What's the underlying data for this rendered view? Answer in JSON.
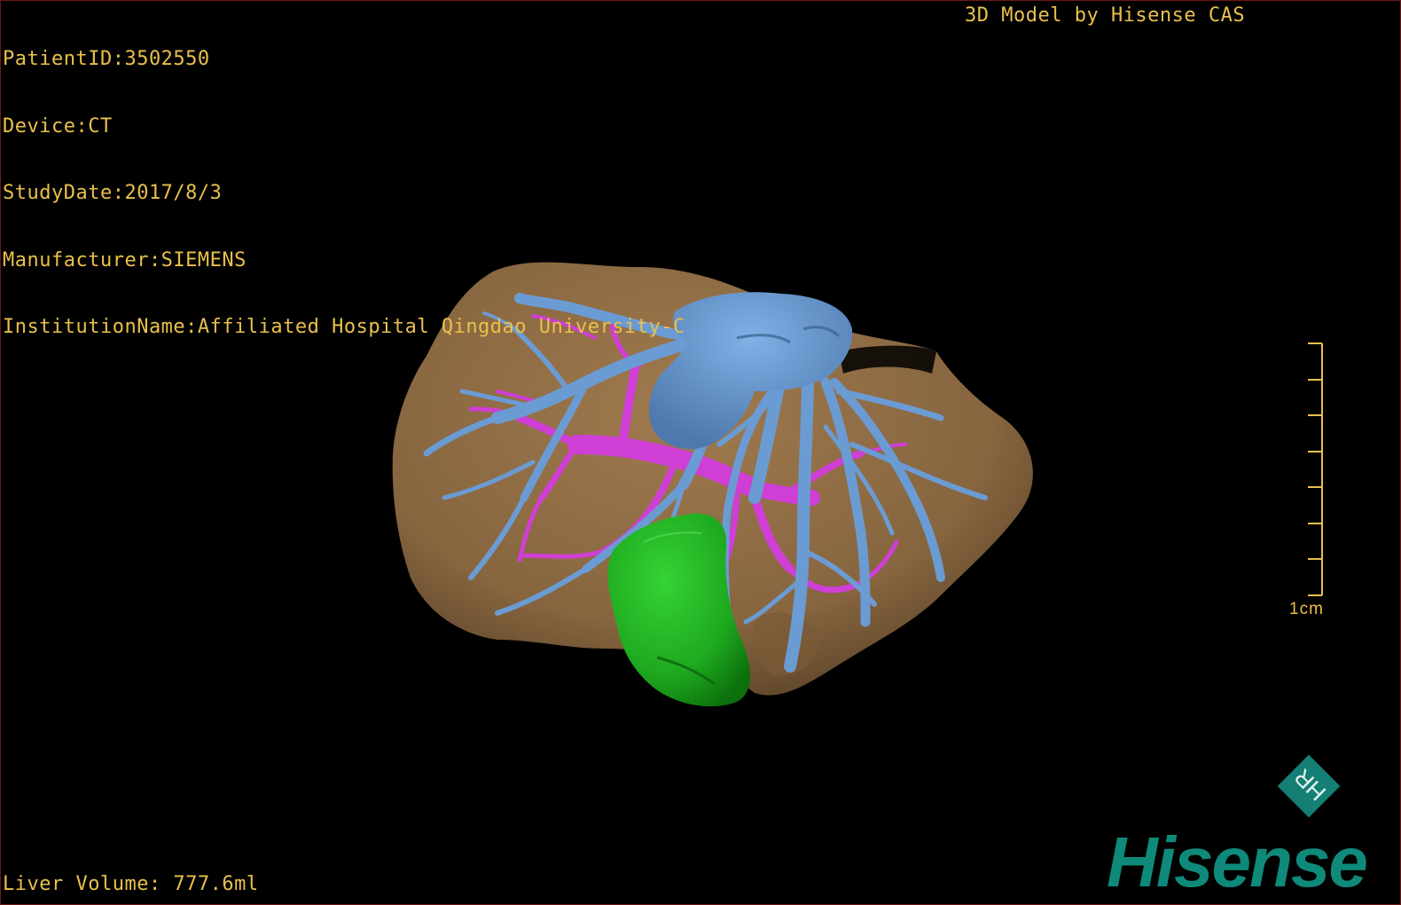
{
  "header": {
    "patient_id": "PatientID:3502550",
    "device": "Device:CT",
    "study_date": "StudyDate:2017/8/3",
    "manufacturer": "Manufacturer:SIEMENS",
    "institution": "InstitutionName:Affiliated Hospital Qingdao University-C"
  },
  "credit": "3D Model by Hisense CAS",
  "footer": {
    "liver_volume": "Liver Volume: 777.6ml"
  },
  "scale_bar": {
    "label": "1cm"
  },
  "brand": {
    "name": "Hisense",
    "badge_letters": "HR"
  },
  "colors": {
    "overlay_text": "#e9c04b",
    "liver": "#8c6a45",
    "hepatic_vein": "#6f9fd8",
    "portal_vein": "#d13fd6",
    "gallbladder": "#1fb31f",
    "brand": "#0f8a7a"
  },
  "model_structures": [
    "liver",
    "hepatic-vein",
    "portal-vein",
    "gallbladder"
  ]
}
